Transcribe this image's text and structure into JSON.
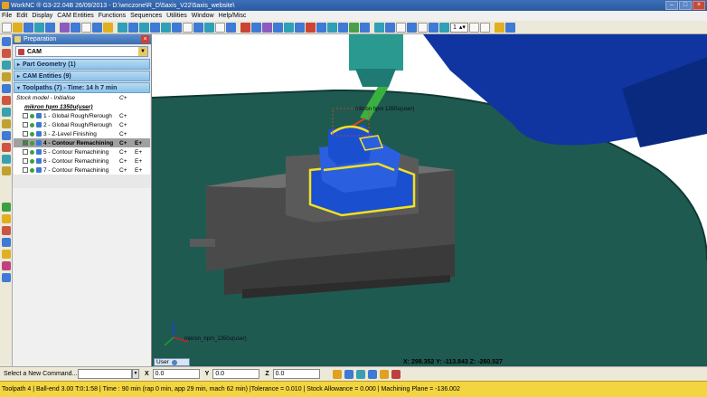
{
  "window": {
    "title": "WorkNC ® G3-22.04B  26/09/2013 - D:\\wnczone\\R_D\\5axis_V22\\5axis_website\\"
  },
  "menu": [
    "File",
    "Edit",
    "Display",
    "CAM Entities",
    "Functions",
    "Sequences",
    "Utilities",
    "Window",
    "Help/Misc"
  ],
  "toolbar": {
    "spin_value": "1"
  },
  "panel": {
    "header": "Preparation",
    "combo_value": "CAM",
    "sections": {
      "part_geometry": "Part Geometry (1)",
      "cam_entities": "CAM Entities (9)",
      "toolpaths": "Toolpaths (7) - Time: 14 h 7 min"
    },
    "tree": {
      "stock_model": {
        "label": "Stock model - Initialise",
        "c1": "C+"
      },
      "machine": {
        "label": "mikron hpm 1350u(user)"
      },
      "toolpaths": [
        {
          "label": "1 - Global Rough/Rerough",
          "c1": "C+",
          "c2": "",
          "checked": false
        },
        {
          "label": "2 - Global Rough/Rerough",
          "c1": "C+",
          "c2": "",
          "checked": false
        },
        {
          "label": "3 - Z-Level Finishing",
          "c1": "C+",
          "c2": "",
          "checked": false
        },
        {
          "label": "4 - Contour Remachining",
          "c1": "C+",
          "c2": "E+",
          "checked": true
        },
        {
          "label": "5 - Contour Remachining",
          "c1": "C+",
          "c2": "E+",
          "checked": false
        },
        {
          "label": "6 - Contour Remachining",
          "c1": "C+",
          "c2": "E+",
          "checked": false
        },
        {
          "label": "7 - Contour Remachining",
          "c1": "C+",
          "c2": "E+",
          "checked": false
        }
      ]
    }
  },
  "viewport": {
    "machine_label": "mikron hpm 1350u(user)",
    "frame_label": "mikron_hpm_1350u(user)",
    "coordinates": "X:  298.352   Y:  -113.843   Z:  -260.527",
    "tab_label": "User"
  },
  "command": {
    "label": "Select a New Command...",
    "x_label": "X",
    "x_value": "0.0",
    "y_label": "Y",
    "y_value": "0.0",
    "z_label": "Z",
    "z_value": "0.0"
  },
  "status": {
    "text": "Toolpath 4 | Ball-end 3.00 T:0:1:58 | Time : 90 min (rap 0 min, app 29 min, mach 62 min) |Tolerance = 0.010 | Stock Allowance = 0.000 | Machining Plane = -136.002"
  },
  "colors": {
    "machine_table": "#1f5a50",
    "spindle_blue": "#1035a0",
    "part_blue": "#1a4fd0",
    "toolpath_yellow": "#f5e020",
    "status_yellow": "#f3d542"
  }
}
